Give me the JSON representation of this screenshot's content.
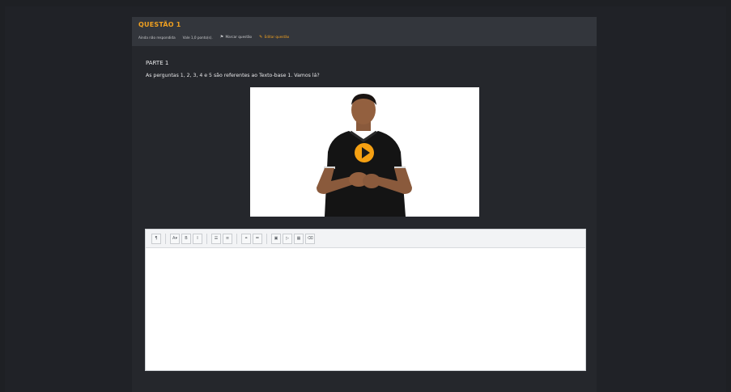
{
  "question": {
    "title": "QUESTÃO 1",
    "meta": {
      "status": "Ainda não respondida",
      "value": "Vale 1,0 ponto(s).",
      "mark_label": "Marcar questão",
      "mark_icon": "flag-icon",
      "edit_label": "Editar questão",
      "edit_icon": "pencil-icon"
    }
  },
  "content": {
    "part_label": "PARTE 1",
    "instruction": "As perguntas 1, 2, 3, 4 e 5 são referentes ao Texto-base 1. Vamos lá?"
  },
  "video": {
    "play_icon": "play-icon"
  },
  "editor": {
    "toolbar": [
      {
        "icon": "paragraph-icon",
        "glyph": "¶"
      },
      {
        "icon": "font-size-icon",
        "glyph": "A▾"
      },
      {
        "icon": "bold-icon",
        "glyph": "B"
      },
      {
        "icon": "italic-icon",
        "glyph": "I"
      },
      {
        "icon": "bullet-list-icon",
        "glyph": "☰"
      },
      {
        "icon": "numbered-list-icon",
        "glyph": "≡"
      },
      {
        "icon": "link-icon",
        "glyph": "⚭"
      },
      {
        "icon": "unlink-icon",
        "glyph": "⚮"
      },
      {
        "icon": "image-icon",
        "glyph": "▣"
      },
      {
        "icon": "media-icon",
        "glyph": "▷"
      },
      {
        "icon": "table-icon",
        "glyph": "▦"
      },
      {
        "icon": "clear-format-icon",
        "glyph": "⌫"
      }
    ],
    "value": ""
  },
  "colors": {
    "accent": "#f5a012",
    "background": "#1e2024",
    "panel": "#25272c",
    "header": "#33363c"
  }
}
